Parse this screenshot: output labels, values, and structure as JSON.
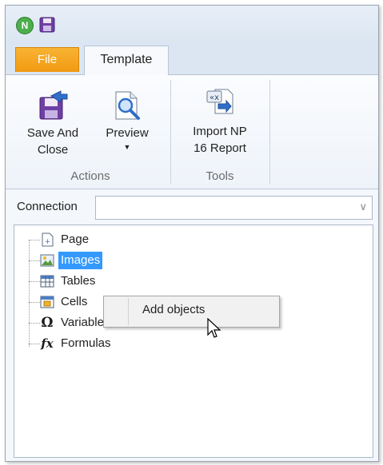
{
  "app": {
    "icon": "qlik-nprinting-icon",
    "quick_save_icon": "save-icon"
  },
  "tabs": [
    {
      "label": "File"
    },
    {
      "label": "Template"
    }
  ],
  "ribbon": {
    "groups": [
      {
        "name": "Actions",
        "buttons": [
          {
            "label_line1": "Save And",
            "label_line2": "Close",
            "icon": "save-close-icon"
          },
          {
            "label_line1": "Preview",
            "icon": "preview-icon",
            "dropdown": true
          }
        ]
      },
      {
        "name": "Tools",
        "buttons": [
          {
            "label_line1": "Import NP",
            "label_line2": "16 Report",
            "icon": "import-report-icon"
          }
        ]
      }
    ]
  },
  "connection": {
    "label": "Connection",
    "value": ""
  },
  "tree": {
    "items": [
      {
        "label": "Page",
        "icon": "page-icon"
      },
      {
        "label": "Images",
        "icon": "image-icon",
        "selected": true
      },
      {
        "label": "Tables",
        "icon": "table-icon"
      },
      {
        "label": "Cells",
        "icon": "cell-icon"
      },
      {
        "label": "Variables",
        "icon": "omega-icon"
      },
      {
        "label": "Formulas",
        "icon": "fx-icon"
      }
    ]
  },
  "context_menu": {
    "items": [
      {
        "label": "Add objects",
        "highlighted": true
      }
    ]
  },
  "colors": {
    "file_tab": "#f19a12",
    "selection": "#3399ff",
    "ribbon_border": "#b9c6d6"
  }
}
